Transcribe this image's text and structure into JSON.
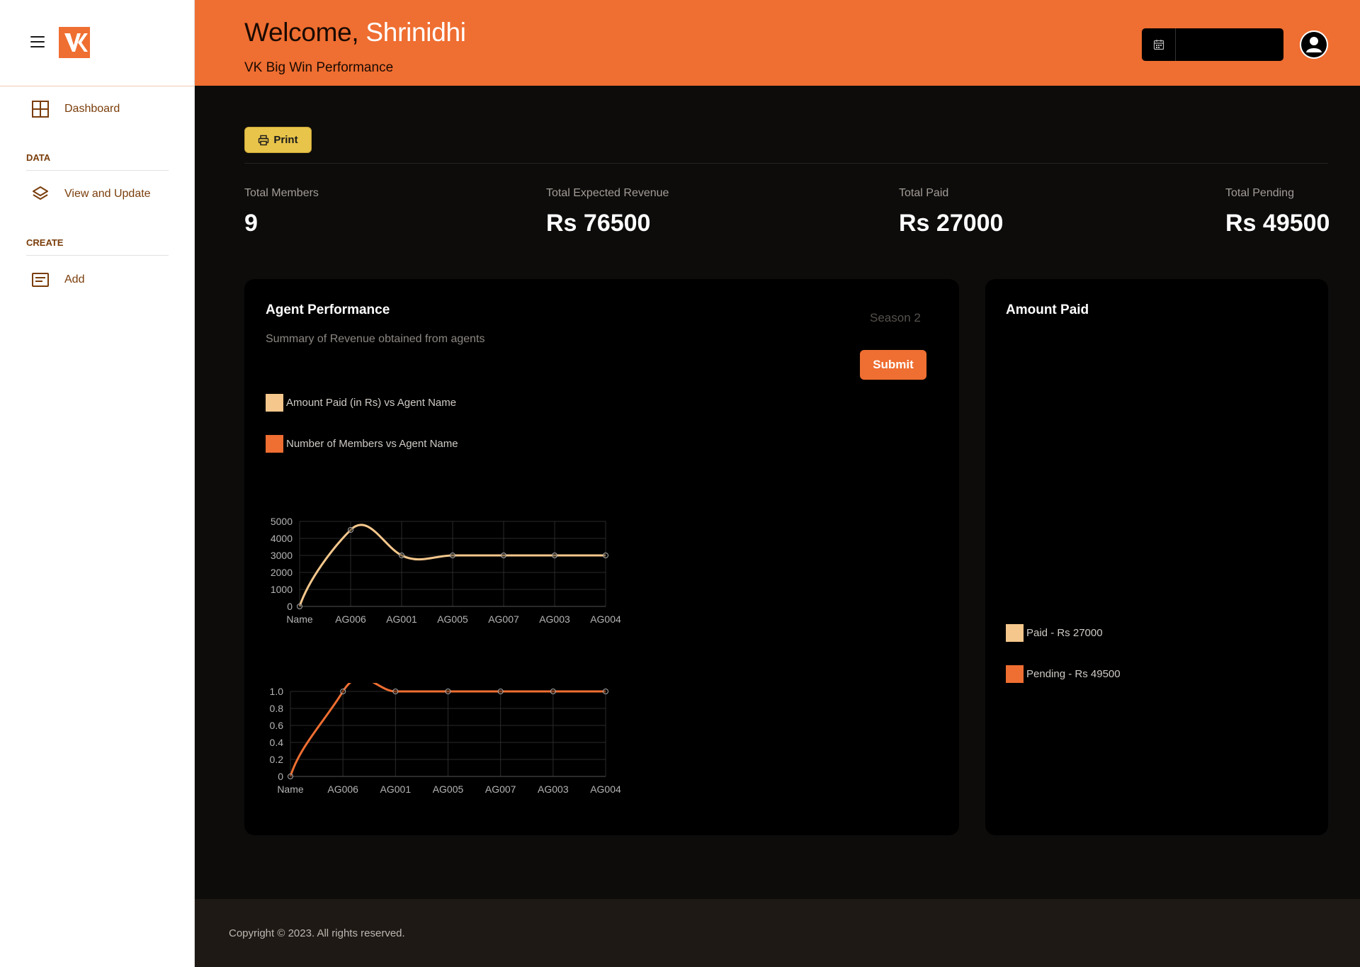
{
  "sidebar": {
    "logo_letter": "K",
    "items": [
      {
        "label": "Dashboard",
        "icon": "grid-icon"
      },
      {
        "label": "View and Update",
        "icon": "layers-icon"
      },
      {
        "label": "Add",
        "icon": "list-icon"
      }
    ],
    "sections": [
      "DATA",
      "CREATE"
    ]
  },
  "header": {
    "welcome_prefix": "Welcome,",
    "user_name": "Shrinidhi",
    "subtitle": "VK Big Win Performance",
    "date_value": ""
  },
  "toolbar": {
    "print_label": "Print"
  },
  "stats": [
    {
      "label": "Total Members",
      "value": "9"
    },
    {
      "label": "Total Expected Revenue",
      "value": "Rs 76500"
    },
    {
      "label": "Total Paid",
      "value": "Rs 27000"
    },
    {
      "label": "Total Pending",
      "value": "Rs 49500"
    }
  ],
  "agent_card": {
    "title": "Agent Performance",
    "subtitle": "Summary of Revenue obtained from agents",
    "season": "Season 2",
    "submit_label": "Submit",
    "legend": [
      {
        "label": "Amount Paid (in Rs) vs Agent Name",
        "color": "#f5c78c"
      },
      {
        "label": "Number of Members vs Agent Name",
        "color": "#ef6e31"
      }
    ]
  },
  "amount_card": {
    "title": "Amount Paid",
    "legend": [
      {
        "label": "Paid - Rs 27000",
        "color": "#f5c78c"
      },
      {
        "label": "Pending - Rs 49500",
        "color": "#ef6e31"
      }
    ]
  },
  "chart_data": [
    {
      "type": "line",
      "categories": [
        "Name",
        "AG006",
        "AG001",
        "AG005",
        "AG007",
        "AG003",
        "AG004"
      ],
      "series": [
        {
          "name": "Amount Paid (in Rs) vs Agent Name",
          "values": [
            0,
            4500,
            3000,
            3000,
            3000,
            3000,
            3000
          ],
          "color": "#f5c78c"
        }
      ],
      "ylim": [
        0,
        5000
      ],
      "yticks": [
        0,
        1000,
        2000,
        3000,
        4000,
        5000
      ],
      "ytick_labels": [
        "0",
        "1000",
        "2000",
        "3000",
        "4000",
        "5000"
      ],
      "grid": true
    },
    {
      "type": "line",
      "categories": [
        "Name",
        "AG006",
        "AG001",
        "AG005",
        "AG007",
        "AG003",
        "AG004"
      ],
      "series": [
        {
          "name": "Number of Members vs Agent Name",
          "values": [
            0,
            1,
            1,
            1,
            1,
            1,
            1
          ],
          "color": "#ef6e31"
        }
      ],
      "ylim": [
        0,
        1
      ],
      "yticks": [
        0,
        0.2,
        0.4,
        0.6,
        0.8,
        1.0
      ],
      "ytick_labels": [
        "0",
        "0.2",
        "0.4",
        "0.6",
        "0.8",
        "1.0"
      ],
      "grid": true
    }
  ],
  "footer": {
    "copyright": "Copyright © 2023. All rights reserved."
  }
}
